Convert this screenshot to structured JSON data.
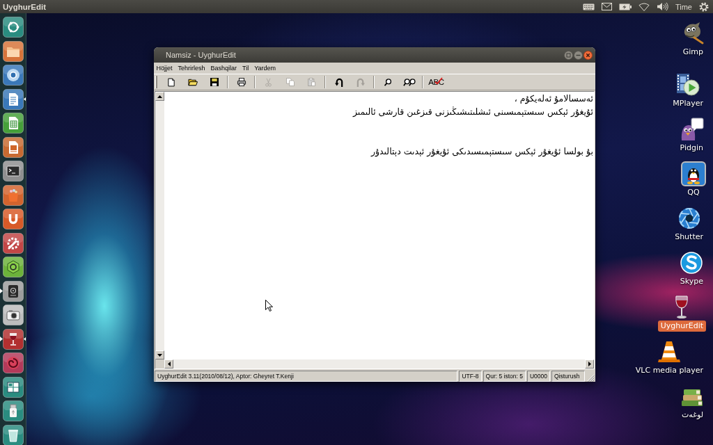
{
  "top_panel": {
    "title": "UyghurEdit",
    "clock": "Time"
  },
  "launcher": {
    "items": [
      {
        "running": false,
        "focused": false
      },
      {
        "running": false,
        "focused": false
      },
      {
        "running": false,
        "focused": false
      },
      {
        "running": false,
        "focused": true
      },
      {
        "running": false,
        "focused": false
      },
      {
        "running": false,
        "focused": false
      },
      {
        "running": false,
        "focused": false
      },
      {
        "running": false,
        "focused": false
      },
      {
        "running": false,
        "focused": false
      },
      {
        "running": false,
        "focused": false
      },
      {
        "running": false,
        "focused": false
      },
      {
        "running": true,
        "focused": false
      },
      {
        "running": false,
        "focused": false
      },
      {
        "running": true,
        "focused": true
      },
      {
        "running": false,
        "focused": false
      },
      {
        "running": false,
        "focused": false
      },
      {
        "running": false,
        "focused": false
      },
      {
        "running": false,
        "focused": false
      }
    ]
  },
  "window": {
    "title": "Namsiz - UyghurEdit",
    "menu": [
      "Höjjet",
      "Tehrirlesh",
      "Bashqilar",
      "Til",
      "Yardem"
    ],
    "toolbar": {
      "groups": [
        [
          {
            "disabled": false
          },
          {
            "disabled": false
          },
          {
            "disabled": false
          }
        ],
        [
          {
            "disabled": false
          }
        ],
        [
          {
            "disabled": true
          },
          {
            "disabled": true
          },
          {
            "disabled": true
          }
        ],
        [
          {
            "disabled": false
          },
          {
            "disabled": true
          }
        ],
        [
          {
            "disabled": false
          },
          {
            "disabled": false
          }
        ],
        [
          {
            "label": "ABC",
            "disabled": false
          }
        ]
      ]
    },
    "editor": {
      "paragraphs": [
        [
          "ئەسسالامۇ ئەلەيكۇم ،",
          "ئۇيغۇر ئېكس سىستېمىسىنى ئىشلىتىشىڭىزنى قىزغىن قارشى ئالىمىز"
        ],
        [
          "بۇ بولسا ئۇيغۇر ئېكس سىستېمىسىدىكى ئۇيغۇر ئېدىت دېتالىدۇر"
        ]
      ]
    },
    "status_bar": [
      "UyghurEdit 3.11(2010/08/12), Aptor: Gheyret T.Kenji",
      "UTF-8",
      "Qur: 5 iston: 5",
      "U0000",
      "Qisturush"
    ]
  },
  "desktop_icons": [
    {
      "label": "Gimp",
      "selected": false
    },
    {
      "label": "MPlayer",
      "selected": false
    },
    {
      "label": "Pidgin",
      "selected": false
    },
    {
      "label": "QQ",
      "selected": false
    },
    {
      "label": "Shutter",
      "selected": false
    },
    {
      "label": "Skype",
      "selected": false
    },
    {
      "label": "UyghurEdit",
      "selected": true
    },
    {
      "label": "VLC media player",
      "selected": false
    },
    {
      "label": "لوغەت",
      "selected": false
    }
  ]
}
